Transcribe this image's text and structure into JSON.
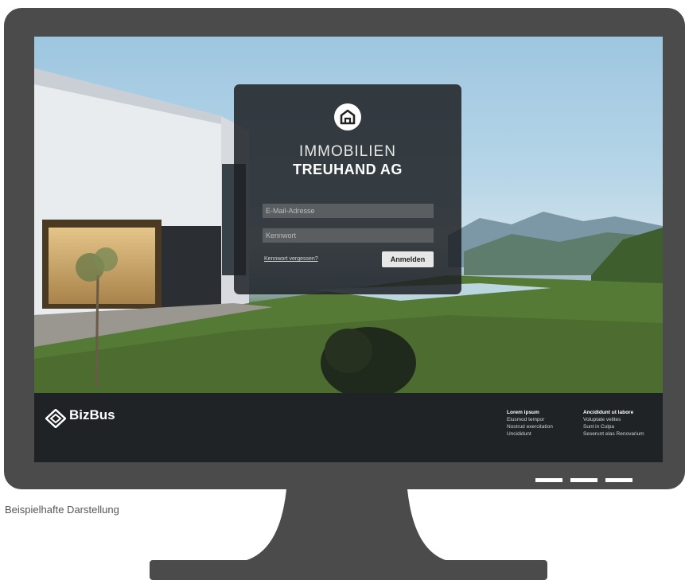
{
  "caption": "Beispielhafte Darstellung",
  "login": {
    "logo_icon": "house-icon",
    "brand_line1": "IMMOBILIEN",
    "brand_line2": "TREUHAND AG",
    "email_placeholder": "E-Mail-Adresse",
    "password_placeholder": "Kennwort",
    "forgot_label": "Kennwort vergessen?",
    "login_label": "Anmelden"
  },
  "footer": {
    "brand_icon": "bizbus-logo-icon",
    "brand_name": "BizBus",
    "columns": [
      {
        "heading": "Lorem ipsum",
        "items": [
          "Eiusmod tempor",
          "Nostrud exercitation",
          "Uncididunt"
        ]
      },
      {
        "heading": "Ancididunt ut labore",
        "items": [
          "Voluptate velites",
          "Sunt in Culpa",
          "Seserunt elas Renovarium"
        ]
      }
    ]
  },
  "colors": {
    "bezel": "#4b4b4b",
    "card": "#1e2225",
    "footer": "#1f2326"
  }
}
